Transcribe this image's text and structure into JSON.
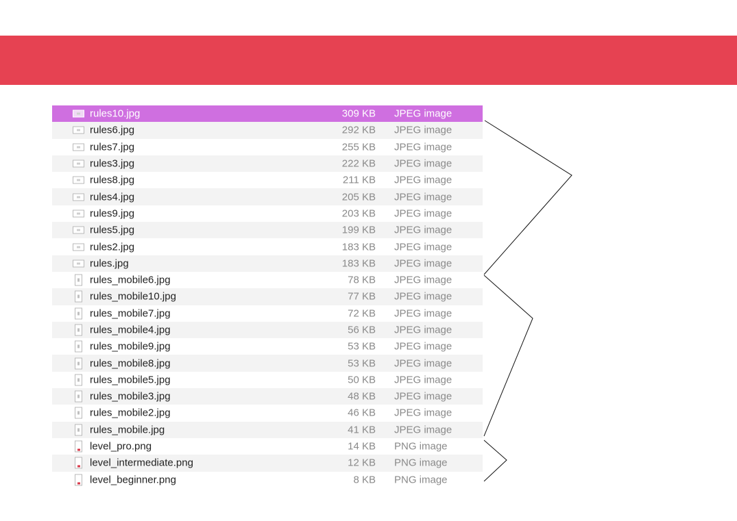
{
  "files": [
    {
      "name": "rules10.jpg",
      "size": "309 KB",
      "kind": "JPEG image",
      "icon": "landscape-image-icon",
      "selected": true
    },
    {
      "name": "rules6.jpg",
      "size": "292 KB",
      "kind": "JPEG image",
      "icon": "landscape-image-icon"
    },
    {
      "name": "rules7.jpg",
      "size": "255 KB",
      "kind": "JPEG image",
      "icon": "landscape-image-icon"
    },
    {
      "name": "rules3.jpg",
      "size": "222 KB",
      "kind": "JPEG image",
      "icon": "landscape-image-icon"
    },
    {
      "name": "rules8.jpg",
      "size": "211 KB",
      "kind": "JPEG image",
      "icon": "landscape-image-icon"
    },
    {
      "name": "rules4.jpg",
      "size": "205 KB",
      "kind": "JPEG image",
      "icon": "landscape-image-icon"
    },
    {
      "name": "rules9.jpg",
      "size": "203 KB",
      "kind": "JPEG image",
      "icon": "landscape-image-icon"
    },
    {
      "name": "rules5.jpg",
      "size": "199 KB",
      "kind": "JPEG image",
      "icon": "landscape-image-icon"
    },
    {
      "name": "rules2.jpg",
      "size": "183 KB",
      "kind": "JPEG image",
      "icon": "landscape-image-icon"
    },
    {
      "name": "rules.jpg",
      "size": "183 KB",
      "kind": "JPEG image",
      "icon": "landscape-image-icon"
    },
    {
      "name": "rules_mobile6.jpg",
      "size": "78 KB",
      "kind": "JPEG image",
      "icon": "portrait-image-icon"
    },
    {
      "name": "rules_mobile10.jpg",
      "size": "77 KB",
      "kind": "JPEG image",
      "icon": "portrait-image-icon"
    },
    {
      "name": "rules_mobile7.jpg",
      "size": "72 KB",
      "kind": "JPEG image",
      "icon": "portrait-image-icon"
    },
    {
      "name": "rules_mobile4.jpg",
      "size": "56 KB",
      "kind": "JPEG image",
      "icon": "portrait-image-icon"
    },
    {
      "name": "rules_mobile9.jpg",
      "size": "53 KB",
      "kind": "JPEG image",
      "icon": "portrait-image-icon"
    },
    {
      "name": "rules_mobile8.jpg",
      "size": "53 KB",
      "kind": "JPEG image",
      "icon": "portrait-image-icon"
    },
    {
      "name": "rules_mobile5.jpg",
      "size": "50 KB",
      "kind": "JPEG image",
      "icon": "portrait-image-icon"
    },
    {
      "name": "rules_mobile3.jpg",
      "size": "48 KB",
      "kind": "JPEG image",
      "icon": "portrait-image-icon"
    },
    {
      "name": "rules_mobile2.jpg",
      "size": "46 KB",
      "kind": "JPEG image",
      "icon": "portrait-image-icon"
    },
    {
      "name": "rules_mobile.jpg",
      "size": "41 KB",
      "kind": "JPEG image",
      "icon": "portrait-image-icon"
    },
    {
      "name": "level_pro.png",
      "size": "14 KB",
      "kind": "PNG image",
      "icon": "png-image-icon"
    },
    {
      "name": "level_intermediate.png",
      "size": "12 KB",
      "kind": "PNG image",
      "icon": "png-image-icon"
    },
    {
      "name": "level_beginner.png",
      "size": "8 KB",
      "kind": "PNG image",
      "icon": "png-image-icon"
    }
  ],
  "colors": {
    "banner": "#e64252",
    "selection": "#cf6fe0",
    "alternate_row": "#f3f3f3",
    "secondary_text": "#8a8a8a"
  }
}
